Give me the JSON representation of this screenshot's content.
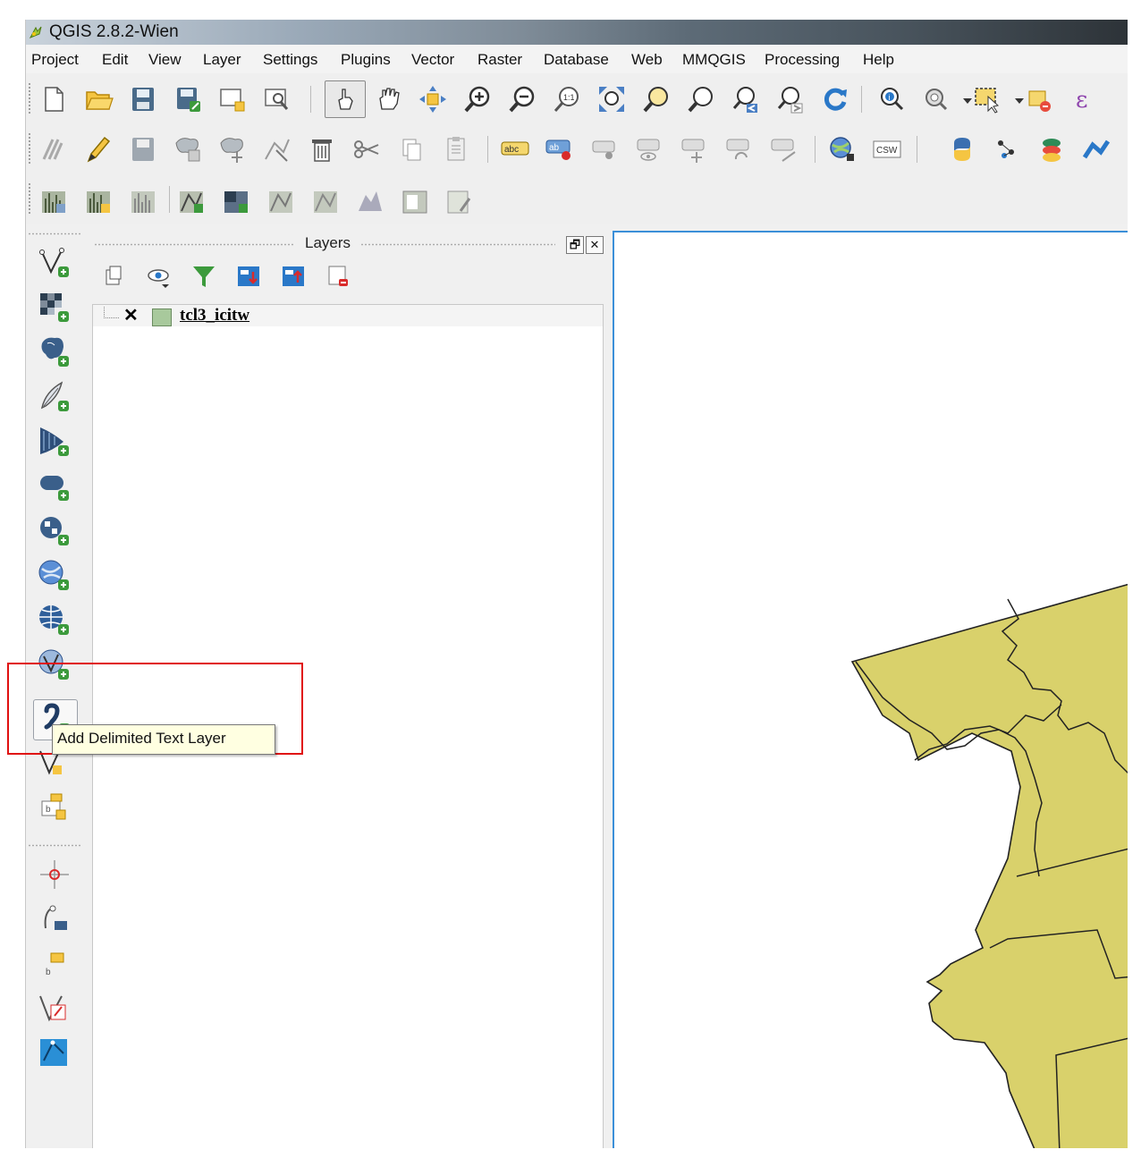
{
  "window": {
    "title": "QGIS 2.8.2-Wien"
  },
  "menu": [
    "Project",
    "Edit",
    "View",
    "Layer",
    "Settings",
    "Plugins",
    "Vector",
    "Raster",
    "Database",
    "Web",
    "MMQGIS",
    "Processing",
    "Help"
  ],
  "toolbar_labels": {
    "csw": "CSW",
    "abc": "abc",
    "ab": "ab",
    "one_to_one": "1:1",
    "epsilon": "ε"
  },
  "layers_panel": {
    "title": "Layers",
    "float_symbol": "🗗",
    "close_symbol": "✕"
  },
  "layers": [
    {
      "name": "tcl3_icitw",
      "visible": true,
      "checkbox_mark": "✕",
      "color": "#a8c99c"
    }
  ],
  "tooltip": {
    "text": "Add Delimited Text Layer"
  },
  "map": {
    "fill_color": "#d9d16b",
    "stroke_color": "#222222"
  },
  "icons": {
    "left_toolbar": [
      "add-vector-layer-icon",
      "add-raster-layer-icon",
      "add-postgis-layer-icon",
      "add-spatialite-layer-icon",
      "add-mssql-layer-icon",
      "add-oracle-layer-icon",
      "add-db2-layer-icon",
      "add-wms-layer-icon",
      "add-wcs-layer-icon",
      "add-wfs-layer-icon",
      "add-delimited-text-layer-icon",
      "new-shapefile-layer-icon",
      "new-spatialite-layer-icon",
      "coordinate-capture-icon",
      "gps-tools-icon",
      "label-tool-icon",
      "topology-checker-icon",
      "georeferencer-icon"
    ]
  }
}
